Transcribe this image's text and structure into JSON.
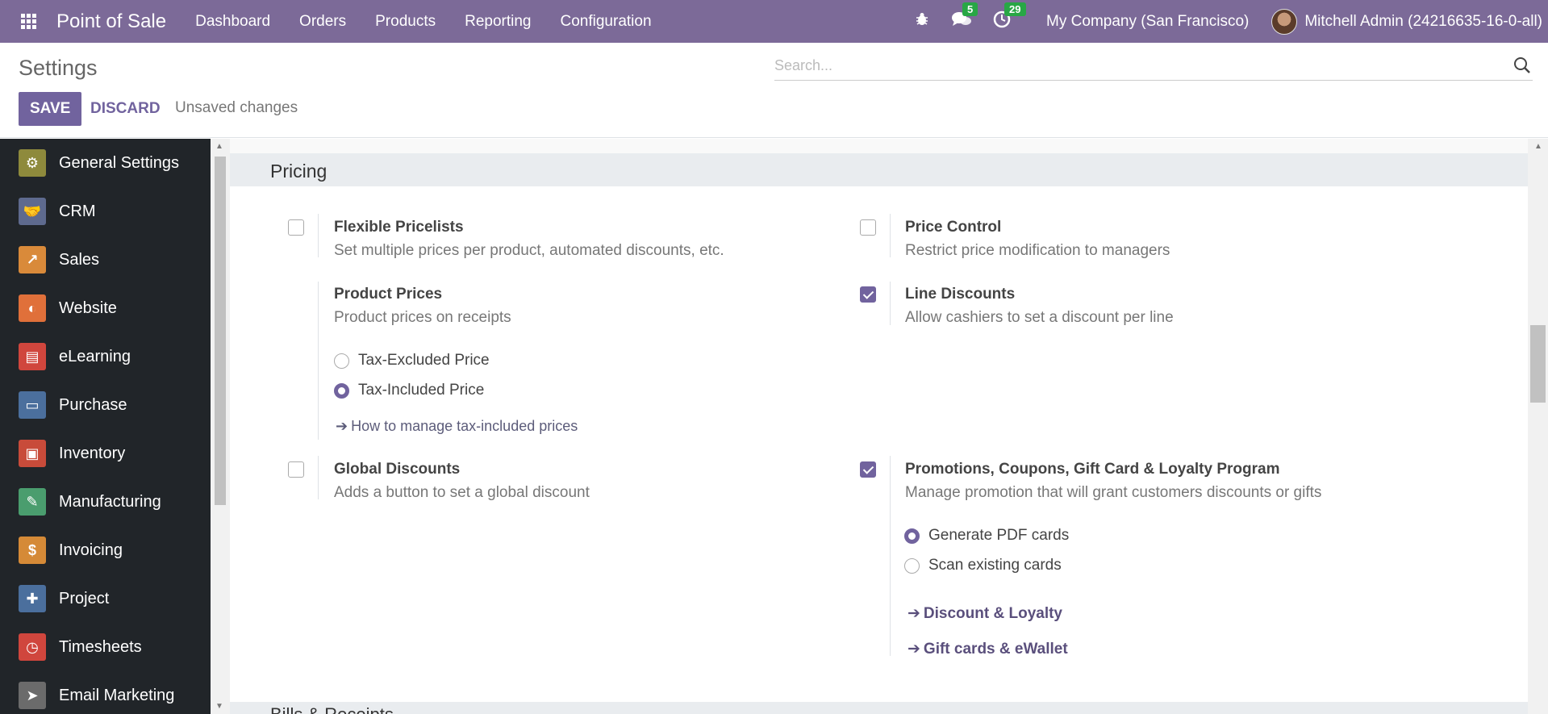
{
  "navbar": {
    "brand": "Point of Sale",
    "menu": [
      "Dashboard",
      "Orders",
      "Products",
      "Reporting",
      "Configuration"
    ],
    "messages_count": "5",
    "activities_count": "29",
    "company": "My Company (San Francisco)",
    "user": "Mitchell Admin (24216635-16-0-all)"
  },
  "control_panel": {
    "title": "Settings",
    "search_placeholder": "Search...",
    "save_label": "SAVE",
    "discard_label": "DISCARD",
    "status": "Unsaved changes"
  },
  "sidebar": {
    "items": [
      {
        "label": "General Settings",
        "icon": "gear-icon",
        "color": "#8e8a3c",
        "glyph": "⚙"
      },
      {
        "label": "CRM",
        "icon": "handshake-icon",
        "color": "#5e6a8e",
        "glyph": "🤝"
      },
      {
        "label": "Sales",
        "icon": "chart-icon",
        "color": "#d98a3a",
        "glyph": "↗"
      },
      {
        "label": "Website",
        "icon": "globe-icon",
        "color": "#e0703a",
        "glyph": "◐"
      },
      {
        "label": "eLearning",
        "icon": "elearning-icon",
        "color": "#d0463d",
        "glyph": "▤"
      },
      {
        "label": "Purchase",
        "icon": "card-icon",
        "color": "#4b6f9d",
        "glyph": "▭"
      },
      {
        "label": "Inventory",
        "icon": "box-icon",
        "color": "#c84b3a",
        "glyph": "▣"
      },
      {
        "label": "Manufacturing",
        "icon": "wrench-icon",
        "color": "#4a9d6e",
        "glyph": "✎"
      },
      {
        "label": "Invoicing",
        "icon": "invoice-icon",
        "color": "#d58a37",
        "glyph": "$"
      },
      {
        "label": "Project",
        "icon": "puzzle-icon",
        "color": "#4b6f9d",
        "glyph": "✚"
      },
      {
        "label": "Timesheets",
        "icon": "stopwatch-icon",
        "color": "#d0463d",
        "glyph": "◷"
      },
      {
        "label": "Email Marketing",
        "icon": "paper-plane-icon",
        "color": "#6b6b6b",
        "glyph": "➤"
      }
    ]
  },
  "section": {
    "title": "Pricing",
    "next_title": "Bills & Receipts"
  },
  "settings": {
    "flexible_pricelists": {
      "title": "Flexible Pricelists",
      "desc": "Set multiple prices per product, automated discounts, etc.",
      "checked": false
    },
    "price_control": {
      "title": "Price Control",
      "desc": "Restrict price modification to managers",
      "checked": false
    },
    "product_prices": {
      "title": "Product Prices",
      "desc": "Product prices on receipts",
      "opt1": "Tax-Excluded Price",
      "opt2": "Tax-Included Price",
      "link": "How to manage tax-included prices"
    },
    "line_discounts": {
      "title": "Line Discounts",
      "desc": "Allow cashiers to set a discount per line",
      "checked": true
    },
    "global_discounts": {
      "title": "Global Discounts",
      "desc": "Adds a button to set a global discount",
      "checked": false
    },
    "promotions": {
      "title": "Promotions, Coupons, Gift Card & Loyalty Program",
      "desc": "Manage promotion that will grant customers discounts or gifts",
      "checked": true,
      "opt1": "Generate PDF cards",
      "opt2": "Scan existing cards",
      "link1": "Discount & Loyalty",
      "link2": "Gift cards & eWallet"
    }
  }
}
